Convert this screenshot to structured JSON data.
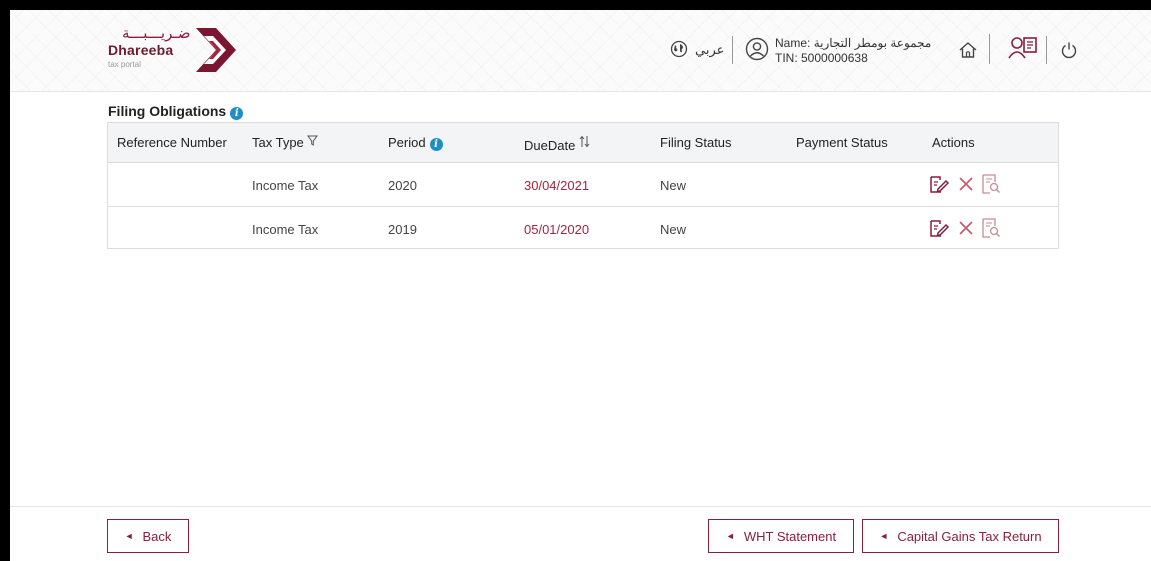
{
  "header": {
    "logo_arabic": "ضـريـــبـــة",
    "logo_name": "Dhareeba",
    "logo_sub": "tax portal",
    "language_label": "عربي",
    "user_name_line": "Name: مجموعة بومطر التجارية",
    "tin_line": "TIN: 5000000638",
    "icons": [
      "globe-icon",
      "user-icon",
      "home-icon",
      "book-user-icon",
      "power-icon"
    ],
    "brand_color": "#8c1d3b"
  },
  "filing": {
    "title": "Filing Obligations",
    "info_glyph": "i",
    "columns": {
      "reference": "Reference Number",
      "tax_type": "Tax Type",
      "period": "Period",
      "due_date": "DueDate",
      "filing_status": "Filing Status",
      "payment_status": "Payment Status",
      "actions": "Actions"
    },
    "rows": [
      {
        "reference": "",
        "tax_type": "Income Tax",
        "period": "2020",
        "due_date": "30/04/2021",
        "filing_status": "New",
        "payment_status": ""
      },
      {
        "reference": "",
        "tax_type": "Income Tax",
        "period": "2019",
        "due_date": "05/01/2020",
        "filing_status": "New",
        "payment_status": ""
      }
    ],
    "due_color": "#a3243c"
  },
  "footer": {
    "back_label": "Back",
    "wht_label": "WHT Statement",
    "cgt_label": "Capital Gains Tax Return",
    "triangle_glyph": "◄"
  }
}
